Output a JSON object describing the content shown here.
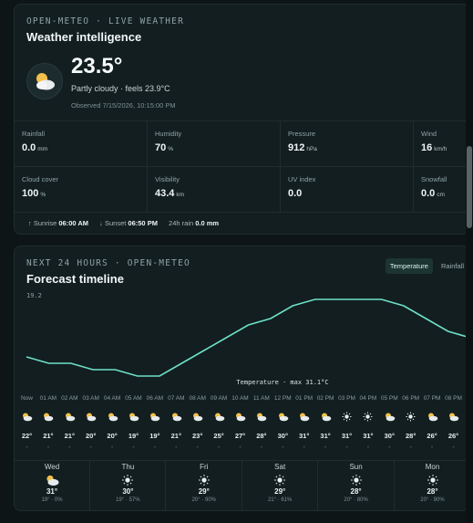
{
  "weather": {
    "kicker": "OPEN-METEO · LIVE WEATHER",
    "title": "Weather intelligence",
    "temperature": "23.5°",
    "condition": "Partly cloudy · feels 23.9°C",
    "observed": "Observed 7/15/2026, 10:15:00 PM",
    "icon": "partly-cloudy-night-icon",
    "metrics": [
      {
        "label": "Rainfall",
        "value": "0.0",
        "unit": "mm"
      },
      {
        "label": "Humidity",
        "value": "70",
        "unit": "%"
      },
      {
        "label": "Pressure",
        "value": "912",
        "unit": "hPa"
      },
      {
        "label": "Wind",
        "value": "16",
        "unit": "km/h"
      },
      {
        "label": "Cloud cover",
        "value": "100",
        "unit": "%"
      },
      {
        "label": "Visibility",
        "value": "43.4",
        "unit": "km"
      },
      {
        "label": "UV index",
        "value": "0.0",
        "unit": ""
      },
      {
        "label": "Snowfall",
        "value": "0.0",
        "unit": "cm"
      }
    ],
    "sunrise_label": "Sunrise",
    "sunrise": "06:00 AM",
    "sunset_label": "Sunset",
    "sunset": "06:50 PM",
    "rain24_label": "24h rain",
    "rain24": "0.0 mm"
  },
  "forecast": {
    "kicker": "NEXT 24 HOURS · OPEN-METEO",
    "title": "Forecast timeline",
    "tabs": [
      {
        "label": "Temperature",
        "active": true
      },
      {
        "label": "Rainfall",
        "active": false
      }
    ],
    "chart_data": {
      "type": "line",
      "y_top_label": "19.2",
      "annotation": "Temperature · max 31.1°C",
      "x": [
        "Now",
        "01 AM",
        "02 AM",
        "03 AM",
        "04 AM",
        "05 AM",
        "06 AM",
        "07 AM",
        "08 AM",
        "09 AM",
        "10 AM",
        "11 AM",
        "12 PM",
        "01 PM",
        "02 PM",
        "03 PM",
        "04 PM",
        "05 PM",
        "06 PM",
        "07 PM",
        "08 PM"
      ],
      "values": [
        22,
        21,
        21,
        20,
        20,
        19,
        19,
        21,
        23,
        25,
        27,
        28,
        30,
        31,
        31,
        31,
        31,
        30,
        28,
        26,
        25
      ],
      "color": "#6ee0c8"
    },
    "hours": [
      {
        "time": "Now",
        "icon": "partly-cloudy-icon",
        "deg": "22°",
        "dash": "-"
      },
      {
        "time": "01 AM",
        "icon": "partly-cloudy-icon",
        "deg": "21°",
        "dash": "-"
      },
      {
        "time": "02 AM",
        "icon": "partly-cloudy-icon",
        "deg": "21°",
        "dash": "-"
      },
      {
        "time": "03 AM",
        "icon": "partly-cloudy-icon",
        "deg": "20°",
        "dash": "-"
      },
      {
        "time": "04 AM",
        "icon": "partly-cloudy-icon",
        "deg": "20°",
        "dash": "-"
      },
      {
        "time": "05 AM",
        "icon": "partly-cloudy-icon",
        "deg": "19°",
        "dash": "-"
      },
      {
        "time": "06 AM",
        "icon": "partly-cloudy-icon",
        "deg": "19°",
        "dash": "-"
      },
      {
        "time": "07 AM",
        "icon": "partly-cloudy-icon",
        "deg": "21°",
        "dash": "-"
      },
      {
        "time": "08 AM",
        "icon": "partly-cloudy-icon",
        "deg": "23°",
        "dash": "-"
      },
      {
        "time": "09 AM",
        "icon": "partly-cloudy-icon",
        "deg": "25°",
        "dash": "-"
      },
      {
        "time": "10 AM",
        "icon": "partly-cloudy-icon",
        "deg": "27°",
        "dash": "-"
      },
      {
        "time": "11 AM",
        "icon": "partly-cloudy-icon",
        "deg": "28°",
        "dash": "-"
      },
      {
        "time": "12 PM",
        "icon": "partly-cloudy-icon",
        "deg": "30°",
        "dash": "-"
      },
      {
        "time": "01 PM",
        "icon": "partly-cloudy-icon",
        "deg": "31°",
        "dash": "-"
      },
      {
        "time": "02 PM",
        "icon": "partly-cloudy-icon",
        "deg": "31°",
        "dash": "-"
      },
      {
        "time": "03 PM",
        "icon": "sun-icon",
        "deg": "31°",
        "dash": "-"
      },
      {
        "time": "04 PM",
        "icon": "sun-icon",
        "deg": "31°",
        "dash": "-"
      },
      {
        "time": "05 PM",
        "icon": "partly-cloudy-icon",
        "deg": "30°",
        "dash": "-"
      },
      {
        "time": "06 PM",
        "icon": "sun-icon",
        "deg": "28°",
        "dash": "-"
      },
      {
        "time": "07 PM",
        "icon": "partly-cloudy-icon",
        "deg": "26°",
        "dash": "-"
      },
      {
        "time": "08 PM",
        "icon": "partly-cloudy-icon",
        "deg": "26°",
        "dash": "-"
      }
    ],
    "days": [
      {
        "name": "Wed",
        "icon": "partly-cloudy-icon",
        "high": "31°",
        "low": "19° · 0%"
      },
      {
        "name": "Thu",
        "icon": "sun-icon",
        "high": "30°",
        "low": "19° · 57%"
      },
      {
        "name": "Fri",
        "icon": "sun-icon",
        "high": "29°",
        "low": "20° · 90%"
      },
      {
        "name": "Sat",
        "icon": "sun-icon",
        "high": "29°",
        "low": "21° · 61%"
      },
      {
        "name": "Sun",
        "icon": "sun-icon",
        "high": "28°",
        "low": "20° · 80%"
      },
      {
        "name": "Mon",
        "icon": "sun-icon",
        "high": "28°",
        "low": "20° · 90%"
      }
    ]
  }
}
